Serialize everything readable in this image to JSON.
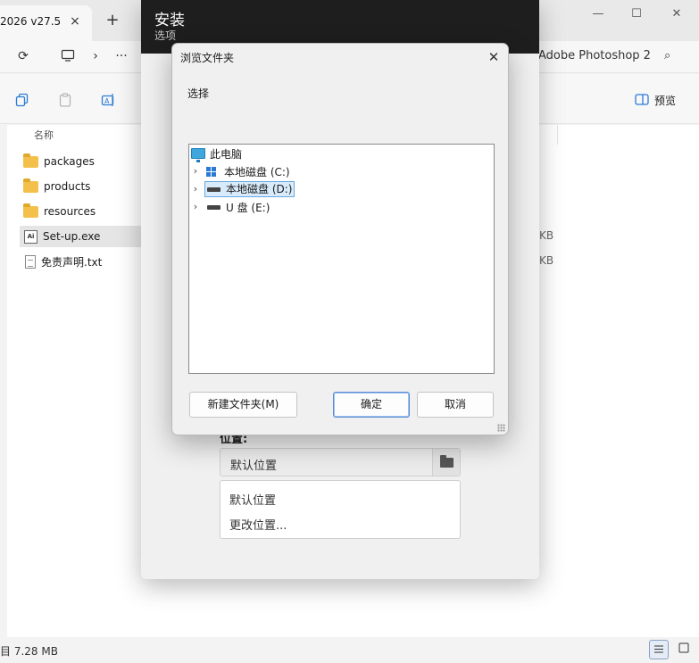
{
  "explorer": {
    "tab_title": "2026 v27.5",
    "breadcrumb_text": "Adobe Photoshop 2",
    "preview_label": "预览",
    "column_header": "名称",
    "files": [
      {
        "name": "packages",
        "type": "folder"
      },
      {
        "name": "products",
        "type": "folder"
      },
      {
        "name": "resources",
        "type": "folder"
      },
      {
        "name": "Set-up.exe",
        "type": "exe"
      },
      {
        "name": "免责声明.txt",
        "type": "txt"
      }
    ],
    "size_fragments": [
      "KB",
      "KB"
    ],
    "status_text": "目  7.28 MB",
    "icons": {
      "tab_close": "×",
      "tab_new": "+",
      "minimize": "—",
      "maximize": "☐",
      "close": "✕",
      "refresh": "⟳",
      "more": "···",
      "chevron": "›",
      "search": "⌕"
    }
  },
  "installer": {
    "title": "安装",
    "subtitle": "选项",
    "location_label": "位置:",
    "location_value": "默认位置",
    "menu_items": [
      "默认位置",
      "更改位置..."
    ]
  },
  "dialog": {
    "title": "浏览文件夹",
    "close_glyph": "✕",
    "prompt": "选择",
    "tree": {
      "root": "此电脑",
      "drives": [
        {
          "label": "本地磁盘 (C:)",
          "selected": false
        },
        {
          "label": "本地磁盘 (D:)",
          "selected": true
        },
        {
          "label": "U 盘 (E:)",
          "selected": false
        }
      ]
    },
    "buttons": {
      "new_folder": "新建文件夹(M)",
      "ok": "确定",
      "cancel": "取消"
    }
  },
  "colors": {
    "accent": "#2b7bd6",
    "header_dark": "#1e1e1e",
    "selection": "#d8ebfb"
  }
}
